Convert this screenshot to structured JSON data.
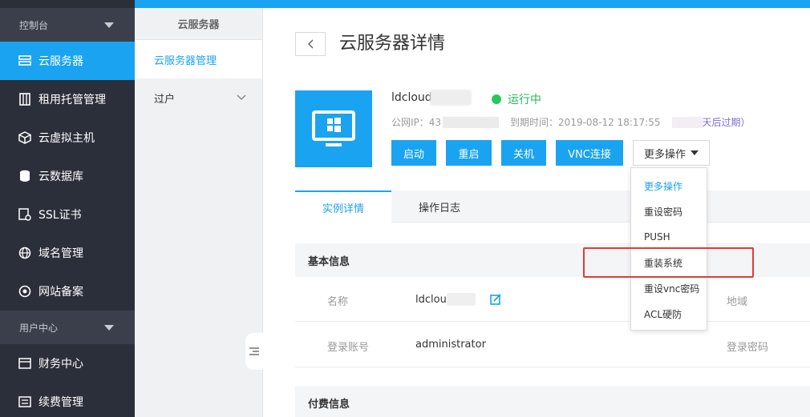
{
  "nav": {
    "section_console": "控制台",
    "items": [
      {
        "label": "云服务器",
        "icon": "server-list-icon"
      },
      {
        "label": "租用托管管理",
        "icon": "hosting-icon"
      },
      {
        "label": "云虚拟主机",
        "icon": "cube-icon"
      },
      {
        "label": "云数据库",
        "icon": "database-icon"
      },
      {
        "label": "SSL证书",
        "icon": "certificate-icon"
      },
      {
        "label": "域名管理",
        "icon": "globe-icon"
      },
      {
        "label": "网站备案",
        "icon": "record-icon"
      }
    ],
    "section_user": "用户中心",
    "user_items": [
      {
        "label": "财务中心",
        "icon": "finance-icon"
      },
      {
        "label": "续费管理",
        "icon": "renew-icon"
      }
    ]
  },
  "subnav": {
    "title": "云服务器",
    "items": [
      {
        "label": "云服务器管理"
      },
      {
        "label": "过户"
      }
    ]
  },
  "main": {
    "page_title": "云服务器详情",
    "server_name": "ldcloud",
    "status": "运行中",
    "ip_label": "公网IP：43",
    "expire_label": "到期时间：2019-08-12 18:17:55",
    "expire_hint": "天后过期）",
    "buttons": {
      "start": "启动",
      "restart": "重启",
      "shutdown": "关机",
      "vnc": "VNC连接",
      "more": "更多操作"
    },
    "tabs": [
      "实例详情",
      "操作日志"
    ],
    "basic_info_title": "基本信息",
    "rows": {
      "name_label": "名称",
      "name_value": "ldclou",
      "region_label": "地域",
      "account_label": "登录账号",
      "account_value": "administrator",
      "password_label": "登录密码"
    },
    "billing_title": "付费信息"
  },
  "dropdown": {
    "items": [
      "更多操作",
      "重设密码",
      "PUSH",
      "重装系统",
      "重设vnc密码",
      "ACL硬防"
    ]
  },
  "colors": {
    "accent": "#1aa3f0",
    "nav_bg": "#2b2f3a",
    "running": "#26c85c",
    "highlight": "#e53935"
  }
}
